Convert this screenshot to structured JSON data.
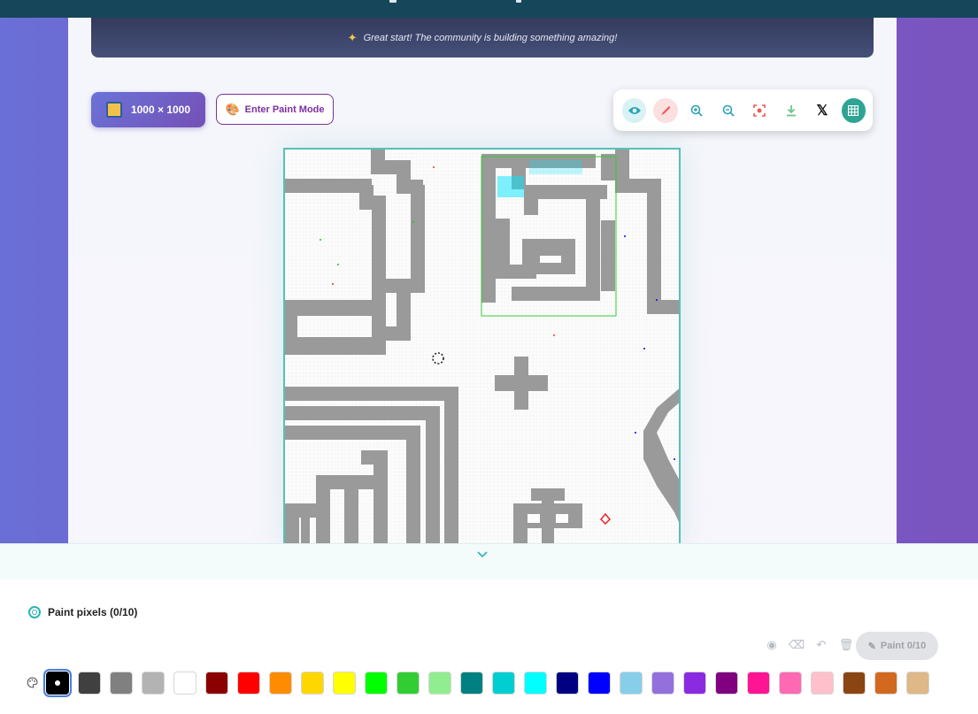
{
  "banner": {
    "message": "Great start! The community is building something amazing!"
  },
  "canvas_controls": {
    "dimensions_label": "1000 × 1000",
    "paint_mode_label": "Enter Paint Mode"
  },
  "toolbar": {
    "icons": [
      "eye-icon",
      "brush-icon",
      "zoom-in-icon",
      "zoom-out-icon",
      "focus-icon",
      "download-icon",
      "x-logo-icon",
      "grid-icon"
    ],
    "x_glyph": "𝕏"
  },
  "paint_panel": {
    "title": "Paint pixels (0/10)",
    "submit_label": "Paint 0/10"
  },
  "palette": {
    "selected": "#000000",
    "colors": [
      "#000000",
      "#404040",
      "#808080",
      "#b3b3b3",
      "#ffffff",
      "#8b0000",
      "#ff0000",
      "#ff8c00",
      "#ffd700",
      "#ffff00",
      "#00ff00",
      "#32cd32",
      "#90ee90",
      "#008080",
      "#00ced1",
      "#00ffff",
      "#000080",
      "#0000ff",
      "#87ceeb",
      "#9370db",
      "#8a2be2",
      "#800080",
      "#ff1493",
      "#ff69b4",
      "#ffc0cb",
      "#8b4513",
      "#d2691e",
      "#deb887"
    ]
  },
  "colors": {
    "accent": "#2fa394",
    "banner_bg": "#3d4568",
    "paint_button": "#7b2fa0"
  }
}
